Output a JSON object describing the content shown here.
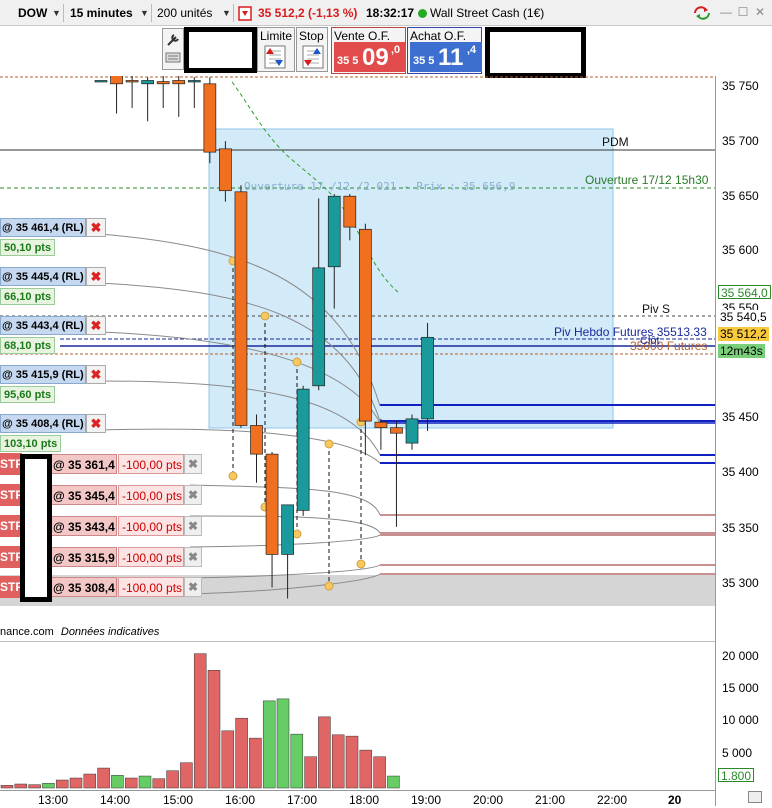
{
  "topbar": {
    "instrument": "DOW",
    "timeframe": "15 minutes",
    "units": "200 unités",
    "price": "35 512,2 (-1,13 %)",
    "time": "18:32:17",
    "market": "Wall Street Cash (1€)"
  },
  "order_panel": {
    "limit_label": "Limite",
    "stop_label": "Stop",
    "sell_label": "Vente O.F.",
    "sell_prefix": "35 5",
    "sell_big": "09",
    "sell_sup": ",0",
    "buy_label": "Achat O.F.",
    "buy_prefix": "35 5",
    "buy_big": "11",
    "buy_sup": ",4"
  },
  "chart": {
    "colors": {
      "up": "#1a9a9a",
      "down": "#f07020",
      "volume_up": "#66cc66",
      "volume_down": "#e06666",
      "zone": "#cfe9f9"
    },
    "zone_label": "Ouverture 17 /12 /2 021  - Prix : 35 656,9",
    "labels": {
      "pdm": "PDM",
      "ouverture": "Ouverture 17/12 15h30",
      "pivs": "Piv S",
      "piv_hebdo": "Piv Hebdo Futures 35513.33",
      "futures": "35000 Futures",
      "close": "Clôt"
    },
    "price_axis": [
      "35 750",
      "35 700",
      "35 650",
      "35 600",
      "35 550",
      "35 450",
      "35 400",
      "35 350",
      "35 300"
    ],
    "price_tags": {
      "p1": "35 564,0",
      "p2": "35 550",
      "p3": "35 540,5",
      "current": "35 512,2",
      "countdown": "12m43s"
    },
    "volume_axis": [
      "20 000",
      "15 000",
      "10 000",
      "5 000"
    ],
    "volume_tag": "1.800",
    "time_axis": [
      "13:00",
      "14:00",
      "15:00",
      "16:00",
      "17:00",
      "18:00",
      "19:00",
      "20:00",
      "21:00",
      "22:00",
      "20"
    ],
    "credit": "nance.com",
    "credit_note": "Données indicatives"
  },
  "take_profits": [
    {
      "price": "@ 35 461,4 (RL)",
      "pts": "50,10 pts"
    },
    {
      "price": "@ 35 445,4 (RL)",
      "pts": "66,10 pts"
    },
    {
      "price": "@ 35 443,4 (RL)",
      "pts": "68,10 pts"
    },
    {
      "price": "@ 35 415,9 (RL)",
      "pts": "95,60 pts"
    },
    {
      "price": "@ 35 408,4 (RL)",
      "pts": "103,10 pts"
    }
  ],
  "stops": [
    {
      "tag": "STP",
      "price": "@ 35 361,4",
      "pts": "-100,00 pts"
    },
    {
      "tag": "STP",
      "price": "@ 35 345,4",
      "pts": "-100,00 pts"
    },
    {
      "tag": "STP",
      "price": "@ 35 343,4",
      "pts": "-100,00 pts"
    },
    {
      "tag": "STP",
      "price": "@ 35 315,9",
      "pts": "-100,00 pts"
    },
    {
      "tag": "STP",
      "price": "@ 35 308,4",
      "pts": "-100,00 pts"
    }
  ],
  "candles": [
    {
      "o": 35755,
      "h": 35755,
      "l": 35755,
      "c": 35755
    },
    {
      "o": 35760,
      "h": 35762,
      "l": 35725,
      "c": 35752
    },
    {
      "o": 35755,
      "h": 35762,
      "l": 35730,
      "c": 35754
    },
    {
      "o": 35752,
      "h": 35758,
      "l": 35718,
      "c": 35755
    },
    {
      "o": 35754,
      "h": 35762,
      "l": 35730,
      "c": 35752
    },
    {
      "o": 35755,
      "h": 35760,
      "l": 35722,
      "c": 35752
    },
    {
      "o": 35755,
      "h": 35758,
      "l": 35730,
      "c": 35755
    },
    {
      "o": 35752,
      "h": 35758,
      "l": 35680,
      "c": 35690
    },
    {
      "o": 35693,
      "h": 35700,
      "l": 35645,
      "c": 35655
    },
    {
      "o": 35654,
      "h": 35660,
      "l": 35440,
      "c": 35442
    },
    {
      "o": 35442,
      "h": 35452,
      "l": 35390,
      "c": 35416
    },
    {
      "o": 35416,
      "h": 35418,
      "l": 35295,
      "c": 35325
    },
    {
      "o": 35325,
      "h": 35370,
      "l": 35285,
      "c": 35370
    },
    {
      "o": 35365,
      "h": 35478,
      "l": 35360,
      "c": 35475
    },
    {
      "o": 35478,
      "h": 35648,
      "l": 35474,
      "c": 35585
    },
    {
      "o": 35586,
      "h": 35652,
      "l": 35548,
      "c": 35650
    },
    {
      "o": 35650,
      "h": 35652,
      "l": 35610,
      "c": 35622
    },
    {
      "o": 35620,
      "h": 35625,
      "l": 35415,
      "c": 35446
    },
    {
      "o": 35445,
      "h": 35448,
      "l": 35420,
      "c": 35440
    },
    {
      "o": 35440,
      "h": 35446,
      "l": 35350,
      "c": 35435
    },
    {
      "o": 35426,
      "h": 35452,
      "l": 35420,
      "c": 35448
    },
    {
      "o": 35448,
      "h": 35535,
      "l": 35437,
      "c": 35522
    }
  ],
  "volumes": [
    {
      "v": 400,
      "up": false
    },
    {
      "v": 600,
      "up": false
    },
    {
      "v": 500,
      "up": false
    },
    {
      "v": 700,
      "up": true
    },
    {
      "v": 1200,
      "up": false
    },
    {
      "v": 1500,
      "up": false
    },
    {
      "v": 2100,
      "up": false
    },
    {
      "v": 3000,
      "up": false
    },
    {
      "v": 1900,
      "up": true
    },
    {
      "v": 1500,
      "up": false
    },
    {
      "v": 1800,
      "up": true
    },
    {
      "v": 1400,
      "up": false
    },
    {
      "v": 2600,
      "up": false
    },
    {
      "v": 3800,
      "up": false
    },
    {
      "v": 20200,
      "up": false
    },
    {
      "v": 17700,
      "up": false
    },
    {
      "v": 8600,
      "up": false
    },
    {
      "v": 10500,
      "up": false
    },
    {
      "v": 7500,
      "up": false
    },
    {
      "v": 13100,
      "up": true
    },
    {
      "v": 13400,
      "up": true
    },
    {
      "v": 8100,
      "up": true
    },
    {
      "v": 4700,
      "up": false
    },
    {
      "v": 10700,
      "up": false
    },
    {
      "v": 8000,
      "up": false
    },
    {
      "v": 7800,
      "up": false
    },
    {
      "v": 5700,
      "up": false
    },
    {
      "v": 4700,
      "up": false
    },
    {
      "v": 1800,
      "up": true
    }
  ]
}
